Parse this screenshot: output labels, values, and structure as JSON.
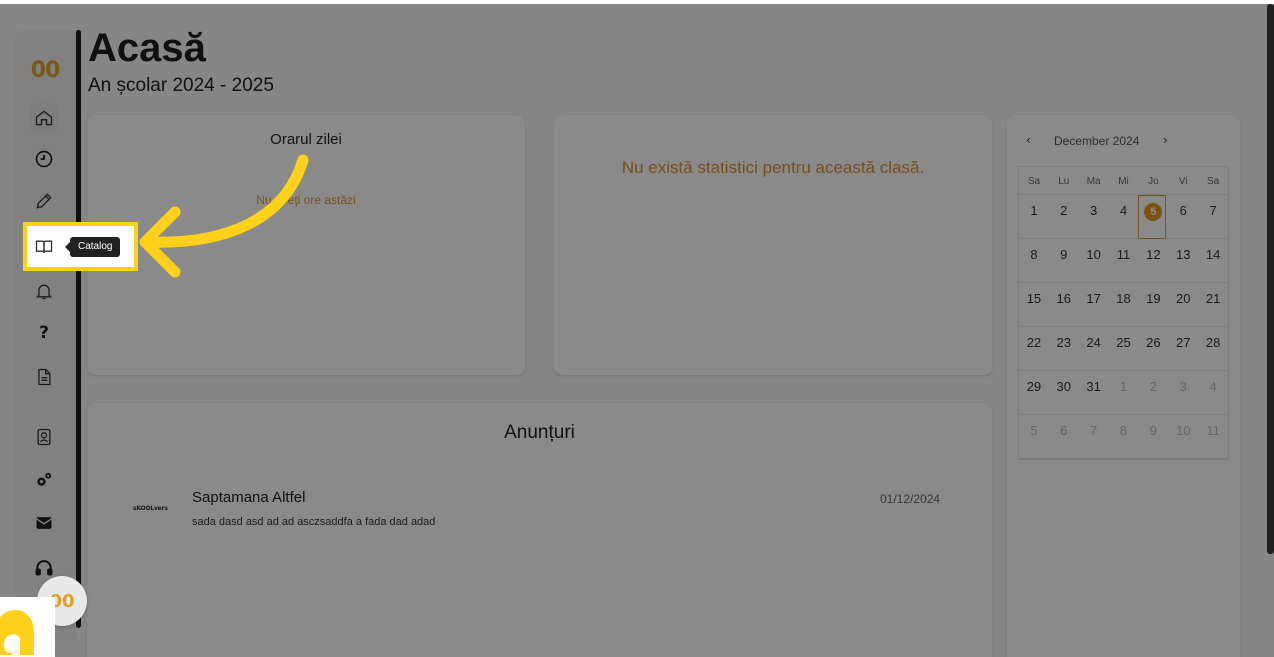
{
  "app": {
    "logo_text": "00",
    "floating_logo_text": "00"
  },
  "header": {
    "title": "Acasă",
    "subtitle": "An școlar 2024 - 2025"
  },
  "sidebar": {
    "items": [
      {
        "name": "home",
        "icon": "home-icon"
      },
      {
        "name": "history",
        "icon": "clock-icon"
      },
      {
        "name": "edit",
        "icon": "pencil-icon"
      },
      {
        "name": "catalog",
        "icon": "book-icon",
        "tooltip": "Catalog"
      },
      {
        "name": "notifications",
        "icon": "bell-icon"
      },
      {
        "name": "help",
        "icon": "question-icon",
        "glyph": "?"
      },
      {
        "name": "documents",
        "icon": "document-icon"
      },
      {
        "name": "contacts",
        "icon": "contact-icon"
      },
      {
        "name": "settings",
        "icon": "gears-icon"
      },
      {
        "name": "messages",
        "icon": "mail-icon"
      },
      {
        "name": "support",
        "icon": "headphones-icon"
      }
    ]
  },
  "schedule": {
    "title": "Orarul zilei",
    "empty_text": "Nu aveți ore astăzi"
  },
  "stats": {
    "message": "Nu există statistici pentru această clasă."
  },
  "announcements": {
    "title": "Anunțuri",
    "items": [
      {
        "logo_text": "sKOOLvers",
        "title": "Saptamana Altfel",
        "body": "sada dasd asd ad ad asczsaddfa a fada dad adad",
        "date": "01/12/2024"
      }
    ]
  },
  "calendar": {
    "prev": "‹",
    "next": "›",
    "month_label": "December 2024",
    "weekdays": [
      "Sa",
      "Lu",
      "Ma",
      "Mi",
      "Jo",
      "Vi",
      "Sa"
    ],
    "weeks": [
      [
        "1",
        "2",
        "3",
        "4",
        "5",
        "6",
        "7"
      ],
      [
        "8",
        "9",
        "10",
        "11",
        "12",
        "13",
        "14"
      ],
      [
        "15",
        "16",
        "17",
        "18",
        "19",
        "20",
        "21"
      ],
      [
        "22",
        "23",
        "24",
        "25",
        "26",
        "27",
        "28"
      ],
      [
        "29",
        "30",
        "31",
        "1",
        "2",
        "3",
        "4"
      ],
      [
        "5",
        "6",
        "7",
        "8",
        "9",
        "10",
        "11"
      ]
    ],
    "today": "5",
    "accent_color": "#e09a22"
  },
  "tooltip": {
    "text": "Catalog"
  },
  "colors": {
    "accent": "#e0a12a",
    "highlight": "#ffd11a",
    "warning_text": "#d1932d"
  }
}
